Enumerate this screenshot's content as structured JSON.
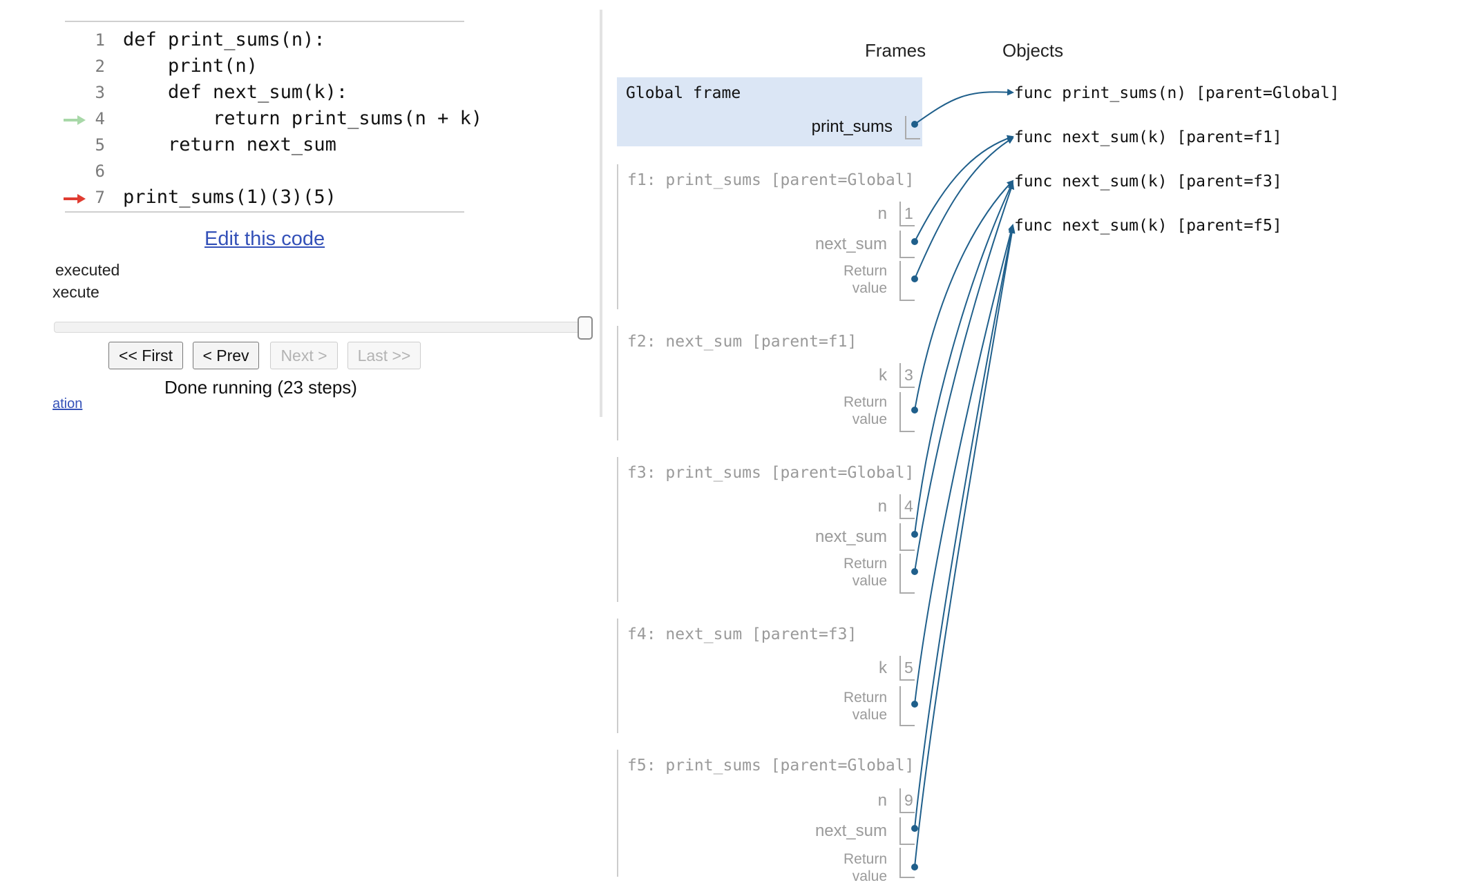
{
  "code": {
    "lines": [
      {
        "num": "1",
        "text": "def print_sums(n):"
      },
      {
        "num": "2",
        "text": "    print(n)"
      },
      {
        "num": "3",
        "text": "    def next_sum(k):"
      },
      {
        "num": "4",
        "text": "        return print_sums(n + k)"
      },
      {
        "num": "5",
        "text": "    return next_sum"
      },
      {
        "num": "6",
        "text": ""
      },
      {
        "num": "7",
        "text": "print_sums(1)(3)(5)"
      }
    ],
    "edit_link": "Edit this code",
    "legend_executed": "executed",
    "legend_execute": "xecute"
  },
  "controls": {
    "first": "<< First",
    "prev": "< Prev",
    "next": "Next >",
    "last": "Last >>",
    "status": "Done running (23 steps)",
    "bottom_link": "ation"
  },
  "viz": {
    "frames_header": "Frames",
    "objects_header": "Objects",
    "global": {
      "title": "Global frame",
      "var": "print_sums"
    },
    "f1": {
      "title": "f1: print_sums [parent=Global]",
      "n_label": "n",
      "n_value": "1",
      "next_label": "next_sum",
      "ret1": "Return",
      "ret2": "value"
    },
    "f2": {
      "title": "f2: next_sum [parent=f1]",
      "k_label": "k",
      "k_value": "3",
      "ret1": "Return",
      "ret2": "value"
    },
    "f3": {
      "title": "f3: print_sums [parent=Global]",
      "n_label": "n",
      "n_value": "4",
      "next_label": "next_sum",
      "ret1": "Return",
      "ret2": "value"
    },
    "f4": {
      "title": "f4: next_sum [parent=f3]",
      "k_label": "k",
      "k_value": "5",
      "ret1": "Return",
      "ret2": "value"
    },
    "f5": {
      "title": "f5: print_sums [parent=Global]",
      "n_label": "n",
      "n_value": "9",
      "next_label": "next_sum",
      "ret1": "Return",
      "ret2": "value"
    },
    "objects": [
      "func print_sums(n) [parent=Global]",
      "func next_sum(k) [parent=f1]",
      "func next_sum(k) [parent=f3]",
      "func next_sum(k) [parent=f5]"
    ]
  },
  "colors": {
    "pointer": "#1f5f8b",
    "prev_line_arrow": "#a8d8a8",
    "next_line_arrow": "#e03c31",
    "link": "#3451b8",
    "global_bg": "#dbe6f5"
  }
}
